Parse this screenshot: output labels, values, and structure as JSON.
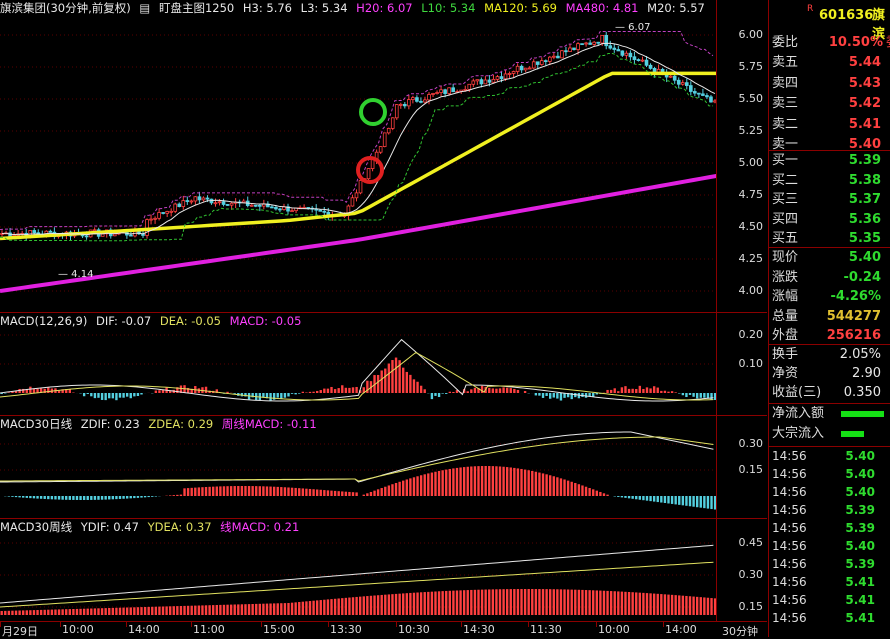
{
  "main": {
    "title": "旗滨集团(30分钟,前复权)",
    "indicator_label": "盯盘主图1250",
    "h3": "H3: 5.76",
    "l3": "L3: 5.34",
    "h20": "H20: 6.07",
    "l10": "L10: 5.34",
    "ma120": "MA120: 5.69",
    "ma480": "MA480: 4.81",
    "m20": "M20: 5.57",
    "high_mark": "6.07",
    "low_mark": "4.14",
    "y_ticks": [
      "6.00",
      "5.75",
      "5.50",
      "5.25",
      "5.00",
      "4.75",
      "4.50",
      "4.25",
      "4.00"
    ]
  },
  "macd1": {
    "title": "MACD(12,26,9)",
    "dif": "DIF: -0.07",
    "dea": "DEA: -0.05",
    "macd": "MACD: -0.05",
    "y_ticks": [
      "0.20",
      "0.10"
    ]
  },
  "macd2": {
    "title": "MACD30日线",
    "zdif": "ZDIF: 0.23",
    "zdea": "ZDEA: 0.29",
    "zmacd": "周线MACD: -0.11",
    "y_ticks": [
      "0.30",
      "0.15"
    ]
  },
  "macd3": {
    "title": "MACD30周线",
    "ydif": "YDIF: 0.47",
    "ydea": "YDEA: 0.37",
    "ymacd": "线MACD: 0.21",
    "y_ticks": [
      "0.45",
      "0.30",
      "0.15"
    ]
  },
  "x_axis": {
    "labels": [
      "月29日",
      "10:00",
      "14:00",
      "11:00",
      "15:00",
      "13:30",
      "10:30",
      "14:30",
      "11:30",
      "10:00",
      "14:00"
    ],
    "period": "30分钟"
  },
  "quote": {
    "flag": "R",
    "code": "601636",
    "name": "旗滨",
    "webi_label": "委比",
    "webi_value": "10.50%",
    "webi_extra": "委",
    "asks": [
      {
        "label": "卖五",
        "price": "5.44"
      },
      {
        "label": "卖四",
        "price": "5.43"
      },
      {
        "label": "卖三",
        "price": "5.42"
      },
      {
        "label": "卖二",
        "price": "5.41"
      },
      {
        "label": "卖一",
        "price": "5.40"
      }
    ],
    "bids": [
      {
        "label": "买一",
        "price": "5.39"
      },
      {
        "label": "买二",
        "price": "5.38"
      },
      {
        "label": "买三",
        "price": "5.37"
      },
      {
        "label": "买四",
        "price": "5.36"
      },
      {
        "label": "买五",
        "price": "5.35"
      }
    ],
    "stats": [
      {
        "label": "现价",
        "value": "5.40",
        "color": "green"
      },
      {
        "label": "涨跌",
        "value": "-0.24",
        "color": "green"
      },
      {
        "label": "涨幅",
        "value": "-4.26%",
        "color": "green"
      },
      {
        "label": "总量",
        "value": "544277",
        "color": "yellow"
      },
      {
        "label": "外盘",
        "value": "256216",
        "color": "red"
      }
    ],
    "stats2": [
      {
        "label": "换手",
        "value": "2.05%"
      },
      {
        "label": "净资",
        "value": "2.90"
      },
      {
        "label": "收益(三)",
        "value": "0.350"
      }
    ],
    "flow": [
      {
        "label": "净流入额",
        "bar_fraction": 0.85
      },
      {
        "label": "大宗流入",
        "bar_fraction": 0.45
      }
    ],
    "ticks": [
      {
        "time": "14:56",
        "price": "5.40"
      },
      {
        "time": "14:56",
        "price": "5.40"
      },
      {
        "time": "14:56",
        "price": "5.40"
      },
      {
        "time": "14:56",
        "price": "5.39"
      },
      {
        "time": "14:56",
        "price": "5.39"
      },
      {
        "time": "14:56",
        "price": "5.40"
      },
      {
        "time": "14:56",
        "price": "5.39"
      },
      {
        "time": "14:56",
        "price": "5.41"
      },
      {
        "time": "14:56",
        "price": "5.41"
      },
      {
        "time": "14:56",
        "price": "5.41"
      }
    ]
  },
  "colors": {
    "up": "#ff4040",
    "down": "#54d0e0",
    "ma120": "#f0f020",
    "ma480": "#e020e0",
    "grid": "#8b0000"
  }
}
